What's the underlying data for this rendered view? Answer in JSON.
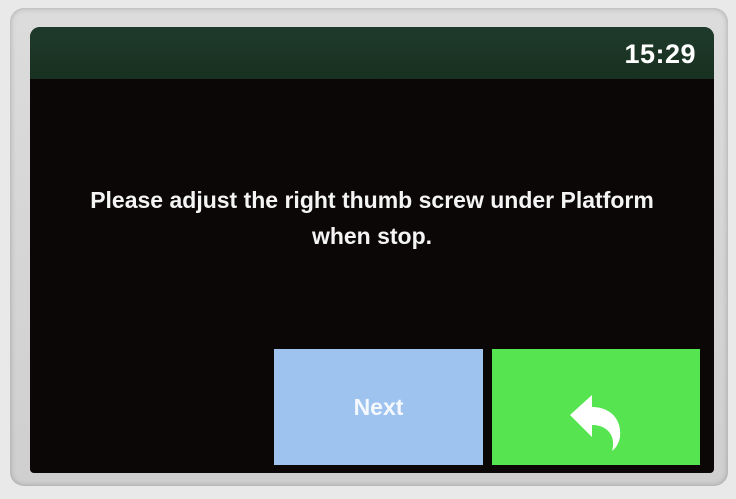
{
  "status_bar": {
    "time": "15:29"
  },
  "message": {
    "line1": "Please adjust the right thumb screw under Platform",
    "line2": "when stop."
  },
  "buttons": {
    "next_label": "Next",
    "back_icon": "undo-arrow-icon"
  },
  "colors": {
    "screen_bg": "#0b0707",
    "status_bar_bg": "#1f3a2c",
    "next_button_bg": "#9ec3ee",
    "back_button_bg": "#57e451"
  }
}
